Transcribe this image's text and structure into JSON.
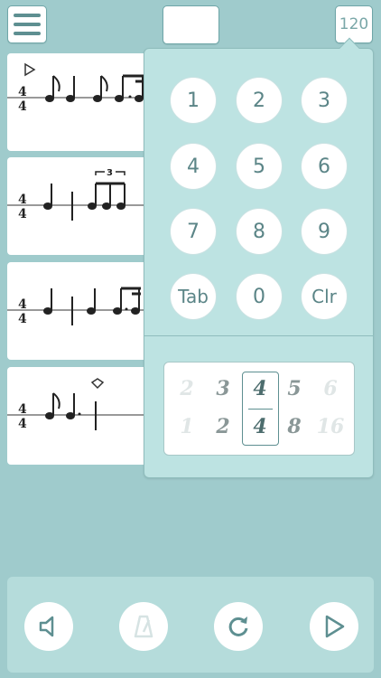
{
  "header": {
    "tempo_label": "120"
  },
  "keypad": {
    "keys": [
      "1",
      "2",
      "3",
      "4",
      "5",
      "6",
      "7",
      "8",
      "9",
      "Tab",
      "0",
      "Clr"
    ]
  },
  "time_signature_picker": {
    "numerators": [
      "2",
      "3",
      "4",
      "5",
      "6"
    ],
    "denominators": [
      "1",
      "2",
      "4",
      "8",
      "16"
    ],
    "selected_index": 2
  },
  "measures": [
    {
      "time_signature": {
        "top": "4",
        "bottom": "4"
      }
    },
    {
      "time_signature": {
        "top": "4",
        "bottom": "4"
      },
      "tuplet_label": "3"
    },
    {
      "time_signature": {
        "top": "4",
        "bottom": "4"
      }
    },
    {
      "time_signature": {
        "top": "4",
        "bottom": "4"
      }
    }
  ],
  "controls": [
    {
      "name": "speaker-icon"
    },
    {
      "name": "metronome-icon"
    },
    {
      "name": "loop-icon"
    },
    {
      "name": "play-icon"
    }
  ],
  "colors": {
    "background": "#9fcbcc",
    "panel": "#bde3e2",
    "accent": "#5e8f91"
  }
}
